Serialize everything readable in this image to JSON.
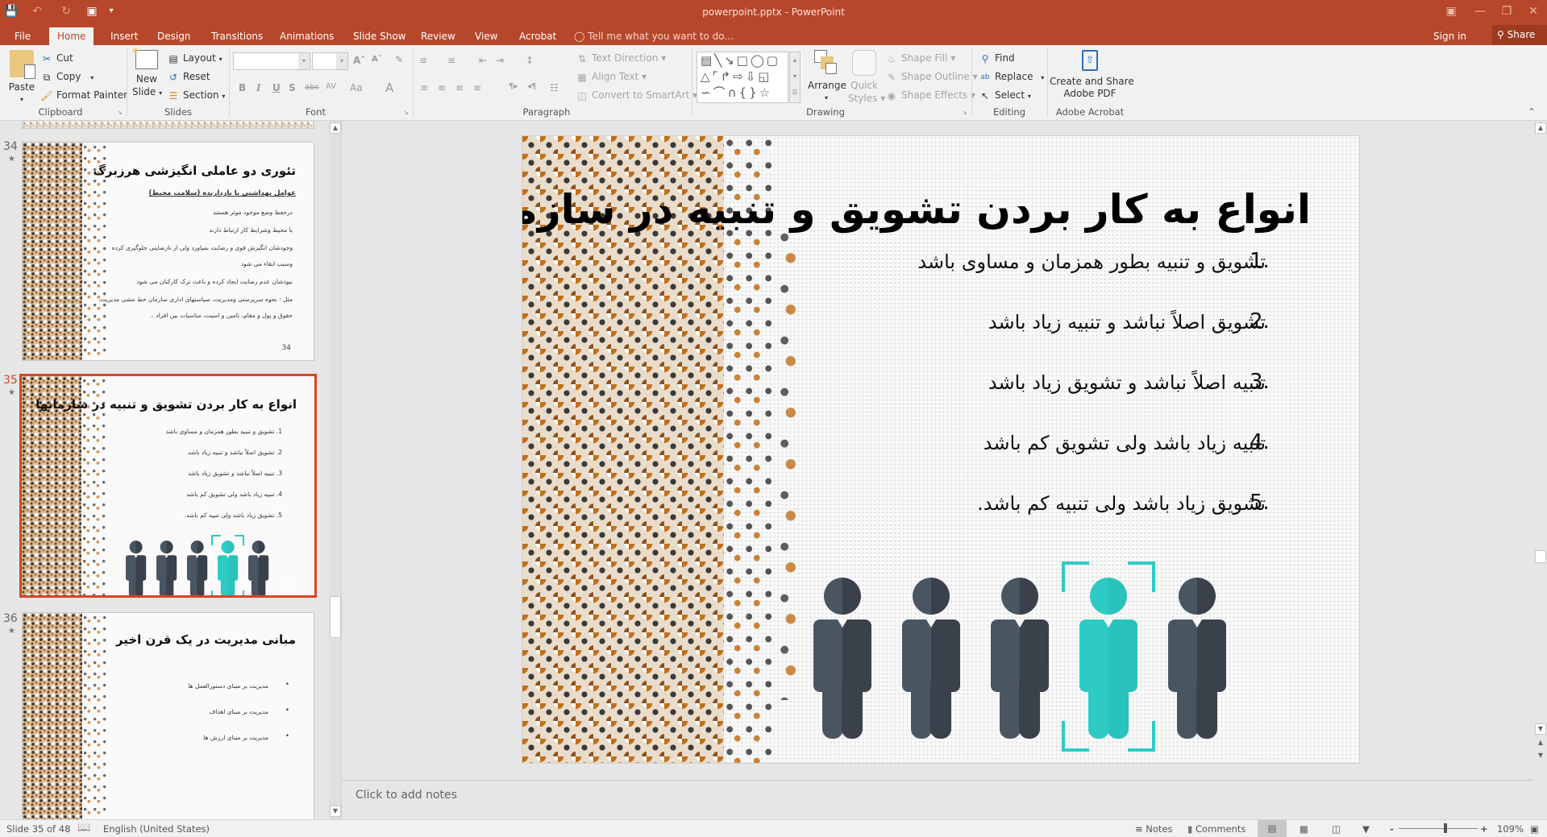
{
  "window": {
    "title": "powerpoint.pptx - PowerPoint",
    "quick_access": [
      "save-icon",
      "undo-icon",
      "redo-icon",
      "start-from-beginning-icon",
      "customize-icon"
    ],
    "controls": [
      "ribbon-display-options",
      "minimize",
      "restore",
      "close"
    ]
  },
  "tabs": {
    "items": [
      "File",
      "Home",
      "Insert",
      "Design",
      "Transitions",
      "Animations",
      "Slide Show",
      "Review",
      "View",
      "Acrobat"
    ],
    "active": "Home",
    "tell_me": "Tell me what you want to do...",
    "sign_in": "Sign in",
    "share": "Share"
  },
  "ribbon": {
    "clipboard": {
      "label": "Clipboard",
      "paste": "Paste",
      "cut": "Cut",
      "copy": "Copy",
      "format_painter": "Format Painter"
    },
    "slides": {
      "label": "Slides",
      "new_slide_1": "New",
      "new_slide_2": "Slide",
      "layout": "Layout",
      "reset": "Reset",
      "section": "Section"
    },
    "font": {
      "label": "Font",
      "font_name": "",
      "font_size": "",
      "bold": "B",
      "italic": "I",
      "underline": "U",
      "shadow": "S",
      "strike": "abc",
      "spacing": "AV",
      "case": "Aa",
      "color": "A",
      "grow": "Aˆ",
      "shrink": "Aˇ"
    },
    "paragraph": {
      "label": "Paragraph",
      "text_direction": "Text Direction",
      "align_text": "Align Text",
      "smartart": "Convert to SmartArt"
    },
    "drawing": {
      "label": "Drawing",
      "arrange": "Arrange",
      "quick_styles_1": "Quick",
      "quick_styles_2": "Styles",
      "shape_fill": "Shape Fill",
      "shape_outline": "Shape Outline",
      "shape_effects": "Shape Effects"
    },
    "editing": {
      "label": "Editing",
      "find": "Find",
      "replace": "Replace",
      "select": "Select"
    },
    "acrobat": {
      "label": "Adobe Acrobat",
      "create_1": "Create and Share",
      "create_2": "Adobe PDF"
    }
  },
  "slide_panel": {
    "thumbnails": [
      {
        "number": "34",
        "title": "تئوری دو عاملی انگیزشی هرزبرگ",
        "subtitle": "عوامل بهداشتی یا بازدارنده (سلامت محیط)",
        "lines": [
          "درحفظ وضع موجود موثر هستند",
          "با محیط وشرایط کار ارتباط دارند",
          "وجودشان انگیزش قوی و رضایت نمیاورد ولی از نارضایتی جلوگیری کرده",
          "وسبب ابقاء می شود",
          "نبودشان عدم رضایت ایجاد کرده و باعث ترک کارکنان می شود",
          "مثل : نحوه سرپرستی ومدیریت، سیاستهای اداری سازمان خط مشی مدیریت،",
          "حقوق و پول و مقام، تامین و امنیت، مناسبات بین افراد .."
        ],
        "page": "34"
      },
      {
        "number": "35",
        "selected": true,
        "title": "انواع به کار بردن تشویق و تنبیه در سازمانها",
        "lines": [
          "1. تشویق و تنبیه بطور همزمان و مساوی باشد",
          "2. تشویق اصلاً نباشد و تنبیه زیاد باشد",
          "3. تنبیه اصلاً نباشد و تشویق زیاد باشد",
          "4. تنبیه زیاد باشد ولی تشویق کم باشد",
          "5. تشویق زیاد باشد ولی تنبیه کم باشد."
        ],
        "page": "35"
      },
      {
        "number": "36",
        "title": "مبانی مدیریت در یک قرن اخیر",
        "lines": [
          "مدیریت بر مبنای دستورالعمل ها",
          "مدیریت بر مبنای اهداف",
          "مدیریت بر مبنای ارزش ها"
        ]
      }
    ]
  },
  "slide": {
    "title": "انواع به کار بردن تشویق و تنبیه در سازمانها",
    "items": [
      {
        "num": "1.",
        "text": "تشویق و تنبیه بطور همزمان و مساوی باشد"
      },
      {
        "num": "2.",
        "text": "تشویق اصلاً نباشد و تنبیه زیاد باشد"
      },
      {
        "num": "3.",
        "text": "تنبیه اصلاً نباشد و تشویق زیاد باشد"
      },
      {
        "num": "4.",
        "text": "تنبیه زیاد باشد ولی تشویق کم باشد"
      },
      {
        "num": "5.",
        "text": "تشویق زیاد باشد ولی تنبیه کم باشد."
      }
    ],
    "people": {
      "count": 5,
      "highlighted_index": 4,
      "colors": {
        "dark_left": "#4a5562",
        "dark_right": "#3a414b",
        "accent_left": "#2ecbc5",
        "accent_right": "#29c2bc"
      }
    }
  },
  "notes": {
    "placeholder": "Click to add notes"
  },
  "status": {
    "slide_info": "Slide 35 of 48",
    "language": "English (United States)",
    "notes": "Notes",
    "comments": "Comments",
    "zoom": "109%",
    "zoom_minus": "-",
    "zoom_plus": "+"
  },
  "colors": {
    "accent": "#b7472a",
    "selection": "#d24726",
    "teal": "#2ecbc5"
  }
}
